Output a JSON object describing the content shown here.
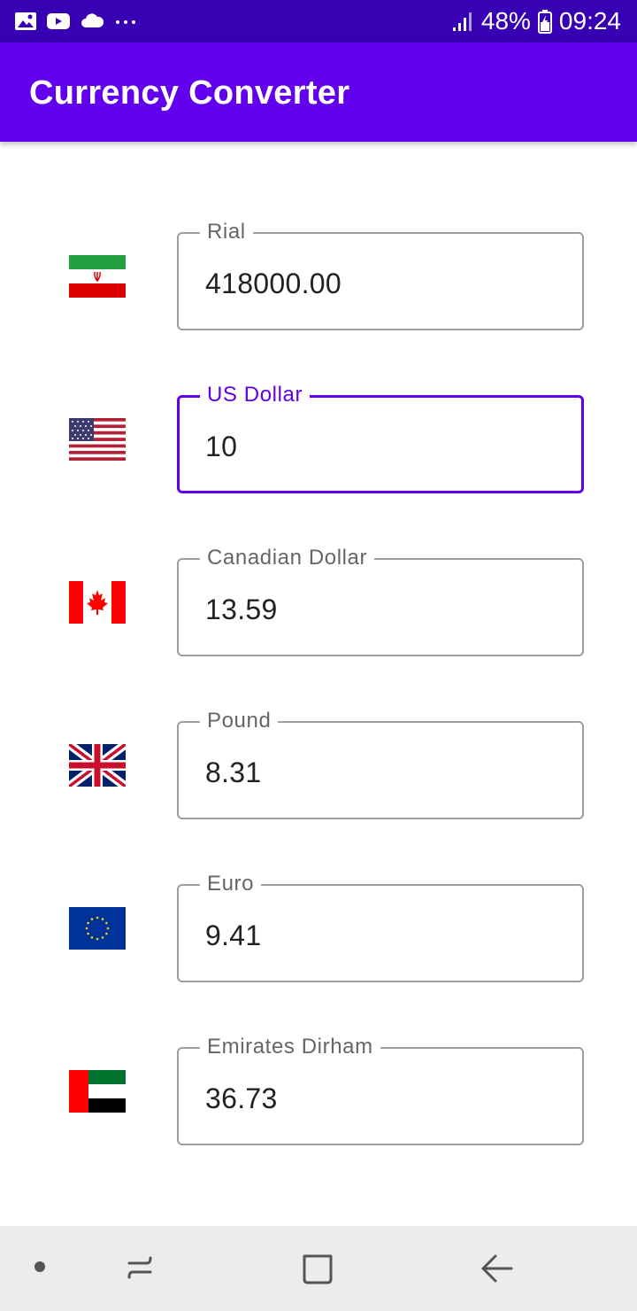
{
  "status_bar": {
    "icons_left": [
      "gallery-icon",
      "youtube-icon",
      "cloud-icon",
      "more-dots-icon"
    ],
    "icons_right": [
      "signal-icon",
      "battery-icon"
    ],
    "battery": "48%",
    "time": "09:24"
  },
  "app_bar": {
    "title": "Currency Converter",
    "color": "#6200ee"
  },
  "currencies": [
    {
      "label": "Rial",
      "value": "418000.00",
      "flag": "iran-flag-icon",
      "focused": false
    },
    {
      "label": "US Dollar",
      "value": "10",
      "flag": "usa-flag-icon",
      "focused": true
    },
    {
      "label": "Canadian Dollar",
      "value": "13.59",
      "flag": "canada-flag-icon",
      "focused": false
    },
    {
      "label": "Pound",
      "value": "8.31",
      "flag": "uk-flag-icon",
      "focused": false
    },
    {
      "label": "Euro",
      "value": "9.41",
      "flag": "eu-flag-icon",
      "focused": false
    },
    {
      "label": "Emirates Dirham",
      "value": "36.73",
      "flag": "uae-flag-icon",
      "focused": false
    }
  ],
  "nav_bar": {
    "buttons": [
      "dot-icon",
      "recent-apps-icon",
      "home-icon",
      "back-icon"
    ]
  }
}
